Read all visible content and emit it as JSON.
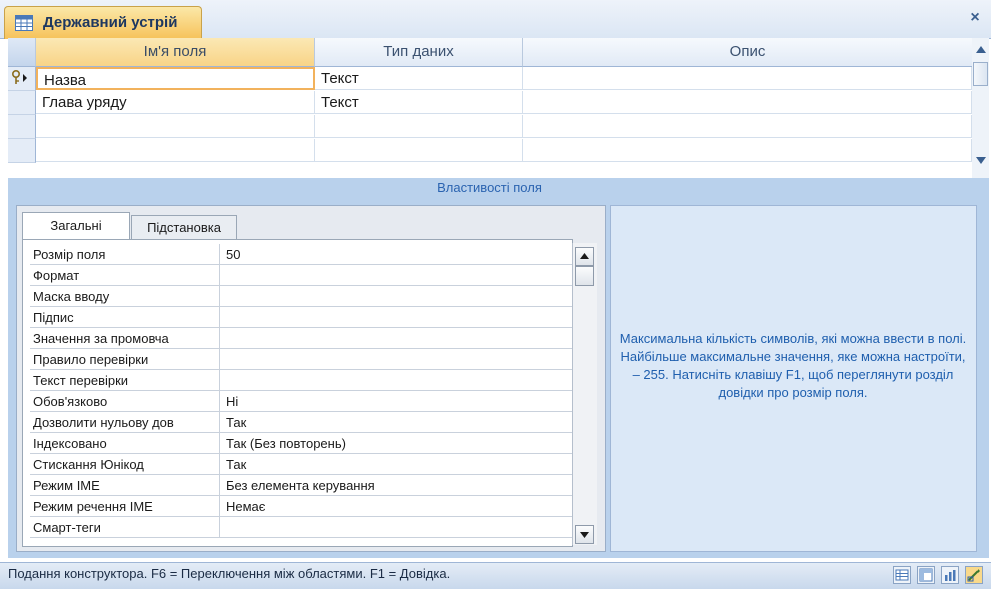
{
  "document_tab": {
    "title": "Державний устрій",
    "icon": "table-icon"
  },
  "close_icon": "×",
  "columns": {
    "name": "Ім'я поля",
    "type": "Тип даних",
    "description": "Опис"
  },
  "fields": [
    {
      "name": "Назва",
      "type": "Текст",
      "description": "",
      "primary_key": true
    },
    {
      "name": "Глава уряду",
      "type": "Текст",
      "description": "",
      "primary_key": false
    }
  ],
  "field_properties_label": "Властивості поля",
  "tabs": {
    "general": "Загальні",
    "lookup": "Підстановка"
  },
  "properties": [
    {
      "label": "Розмір поля",
      "value": "50"
    },
    {
      "label": "Формат",
      "value": ""
    },
    {
      "label": "Маска вводу",
      "value": ""
    },
    {
      "label": "Підпис",
      "value": ""
    },
    {
      "label": "Значення за промовча",
      "value": ""
    },
    {
      "label": "Правило перевірки",
      "value": ""
    },
    {
      "label": "Текст перевірки",
      "value": ""
    },
    {
      "label": "Обов'язково",
      "value": "Ні"
    },
    {
      "label": "Дозволити нульову дов",
      "value": "Так"
    },
    {
      "label": "Індексовано",
      "value": "Так (Без повторень)"
    },
    {
      "label": "Стискання Юнікод",
      "value": "Так"
    },
    {
      "label": "Режим IME",
      "value": "Без елемента керування"
    },
    {
      "label": "Режим речення IME",
      "value": "Немає"
    },
    {
      "label": "Смарт-теги",
      "value": ""
    }
  ],
  "help_text": "Максимальна кількість символів, які можна ввести в полі. Найбільше максимальне значення, яке можна настроїти, – 255. Натисніть клавішу F1, щоб переглянути розділ довідки про розмір поля.",
  "status": {
    "text": "Подання конструктора.  F6 = Переключення між областями.  F1 = Довідка."
  },
  "colors": {
    "accent_tab": "#f6c25a",
    "help_text": "#1f5fae",
    "band": "#b9d1ec"
  }
}
